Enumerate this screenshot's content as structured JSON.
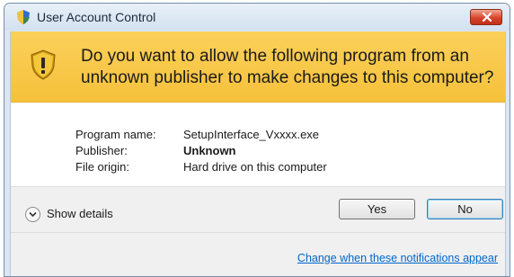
{
  "window": {
    "title": "User Account Control",
    "title_icon": "uac-shield-icon",
    "close_icon": "close-icon"
  },
  "banner": {
    "icon": "warning-shield-icon",
    "question": "Do you want to allow the following program from an unknown publisher to make changes to this computer?",
    "color": "#f6c13b"
  },
  "details": {
    "program_name_label": "Program name:",
    "program_name_value": "SetupInterface_Vxxxx.exe",
    "publisher_label": "Publisher:",
    "publisher_value": "Unknown",
    "file_origin_label": "File origin:",
    "file_origin_value": "Hard drive on this computer"
  },
  "footer": {
    "show_details_label": "Show details",
    "yes_label": "Yes",
    "no_label": "No",
    "change_link": "Change when these notifications appear",
    "link_color": "#0066cc"
  }
}
